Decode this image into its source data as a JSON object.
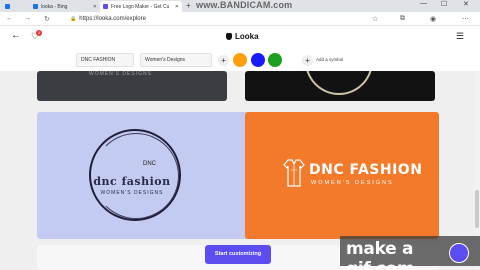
{
  "browser": {
    "tabs": [
      {
        "label": "looka - Bing",
        "favicon_color": "#1a73e8"
      },
      {
        "label": "Free Logo Maker - Get Custom",
        "favicon_color": "#5b4df0"
      }
    ],
    "url": "https://looka.com/explore",
    "watermark": "www.BANDICAM.com"
  },
  "header": {
    "brand": "Looka",
    "favorites_count": "1"
  },
  "editor": {
    "company_name": "DNC FASHION",
    "slogan": "Women's Designs",
    "colors": [
      "#ff9f0a",
      "#1a1aff",
      "#1e9e1e"
    ],
    "add_symbol": "Add a symbol"
  },
  "cards": {
    "top_left_ghost": "WOMEN'S DESIGNS",
    "c3_name": "dnc fashion",
    "c3_sub": "WOMEN'S DESIGNS",
    "c3_tag": "DNC",
    "c4_name": "DNC FASHION",
    "c4_sub": "WOMEN'S DESIGNS"
  },
  "cta": {
    "label": "Start customizing"
  },
  "overlay": {
    "watermark": "make a gif.com"
  }
}
